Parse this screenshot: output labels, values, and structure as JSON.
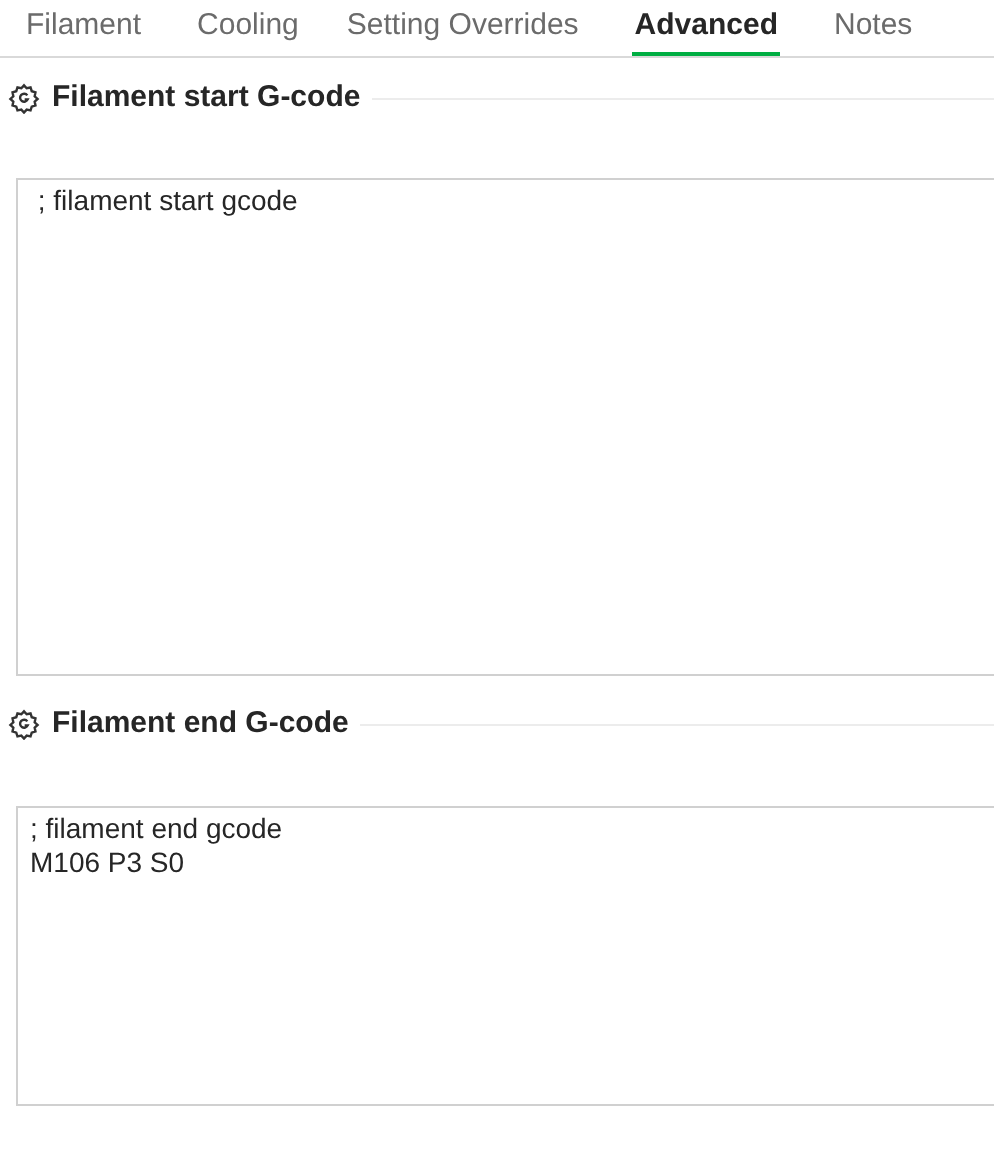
{
  "tabs": [
    {
      "label": "Filament",
      "selected": false
    },
    {
      "label": "Cooling",
      "selected": false
    },
    {
      "label": "Setting Overrides",
      "selected": false
    },
    {
      "label": "Advanced",
      "selected": true
    },
    {
      "label": "Notes",
      "selected": false
    }
  ],
  "sections": [
    {
      "title": "Filament start G-code",
      "value": " ; filament start gcode"
    },
    {
      "title": "Filament end G-code",
      "value": "; filament end gcode\nM106 P3 S0"
    }
  ]
}
